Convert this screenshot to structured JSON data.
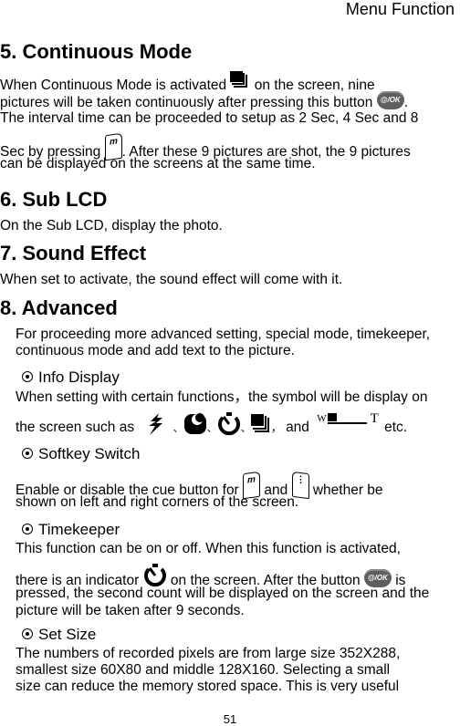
{
  "header": {
    "title": "Menu Function"
  },
  "sections": {
    "continuous": {
      "heading": "5. Continuous Mode",
      "line1a": "When Continuous Mode is activated",
      "line1b": "on the screen, nine",
      "line2a": "pictures will be taken continuously after pressing this button",
      "line2b": ".",
      "line3": "The interval time can be proceeded to setup as 2 Sec, 4 Sec and 8",
      "line4a": "Sec by pressing",
      "line4b": ".    After these 9 pictures are shot, the 9 pictures",
      "line5": "can be displayed on the screens at the same time."
    },
    "sublcd": {
      "heading": "6. Sub LCD",
      "text": "On the Sub LCD, display the photo."
    },
    "sound": {
      "heading": "7. Sound Effect",
      "text": "When set to activate, the sound effect will come with it."
    },
    "advanced": {
      "heading": "8. Advanced",
      "line1": "For proceeding more advanced setting, special mode, timekeeper,",
      "line2": "continuous mode and add text to the picture."
    },
    "info_display": {
      "title": "Info Display",
      "line1": "When setting with certain functions，the symbol will be display on",
      "line2a": "the screen such as",
      "sep": "、",
      "comma": "，",
      "and": "and",
      "etc": "etc.",
      "wt_label_w": "W",
      "wt_label_t": "T"
    },
    "softkey": {
      "title": "Softkey Switch",
      "line1a": "Enable or disable the cue button for",
      "line1b": "and",
      "line1c": "whether be",
      "line2": "shown on left and right corners of the screen.",
      "left_key": "m",
      "right_key": "⋮"
    },
    "timekeeper": {
      "title": "Timekeeper",
      "line1": "This function can be on or off.    When this function is activated,",
      "line2a": "there is an indicator",
      "line2b": "on the screen.    After the button",
      "line2c": "is",
      "line3": "pressed, the second count will be displayed on the screen and the",
      "line4": "picture will be taken after 9 seconds."
    },
    "setsize": {
      "title": "Set Size",
      "line1": "The numbers of recorded pixels are from large size 352X288,",
      "line2": "smallest size 60X80 and middle 128X160.    Selecting a small",
      "line3": "size can reduce the memory stored space.    This is very useful"
    }
  },
  "ok_button_label": "@/OK",
  "menu_key_label": "m",
  "page_number": "51"
}
